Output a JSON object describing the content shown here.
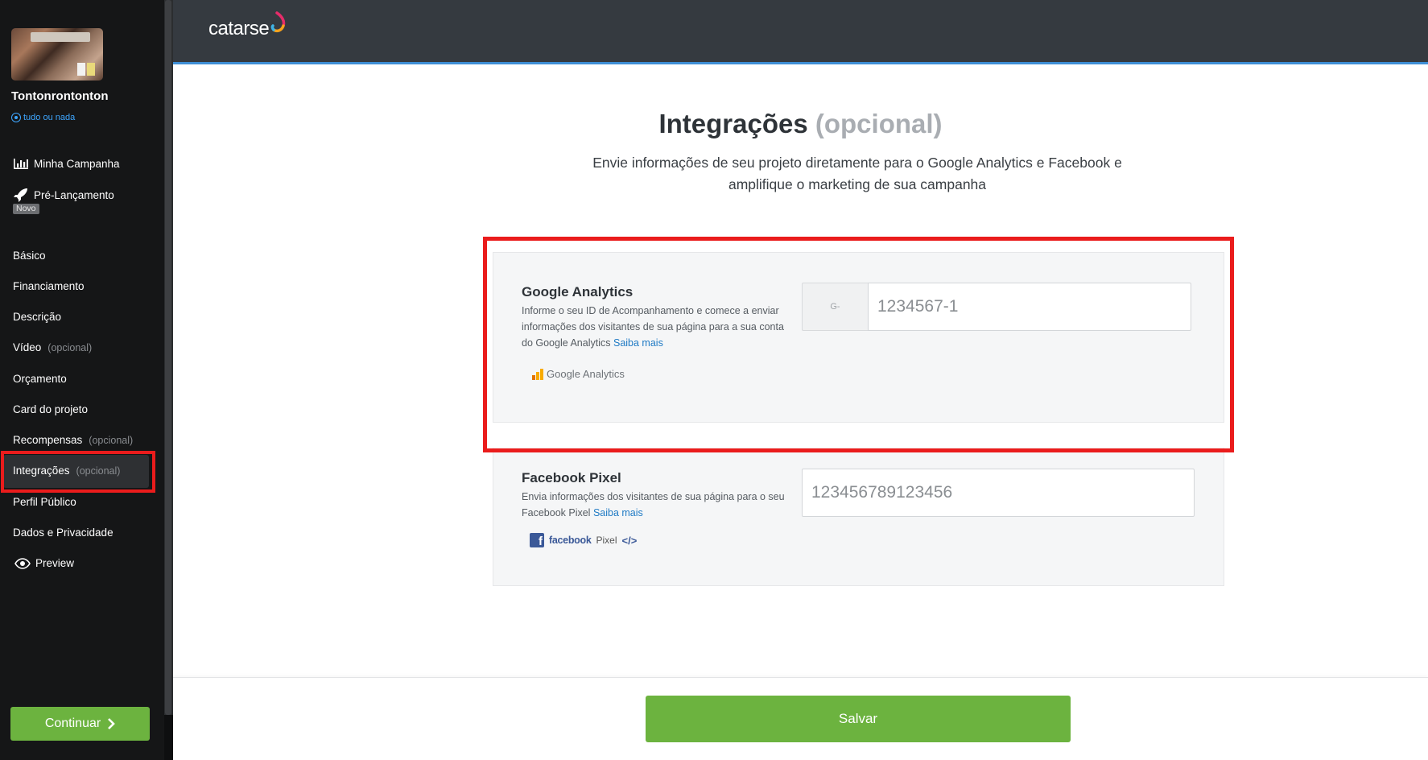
{
  "sidebar": {
    "project_name": "Tontonrontonton",
    "project_mode": "tudo ou nada",
    "primary": [
      {
        "label": "Minha Campanha",
        "icon": "bar-chart-icon"
      },
      {
        "label": "Pré-Lançamento",
        "icon": "rocket-icon",
        "badge": "Novo"
      }
    ],
    "items": [
      {
        "label": "Básico",
        "optional": ""
      },
      {
        "label": "Financiamento",
        "optional": ""
      },
      {
        "label": "Descrição",
        "optional": ""
      },
      {
        "label": "Vídeo",
        "optional": "(opcional)"
      },
      {
        "label": "Orçamento",
        "optional": ""
      },
      {
        "label": "Card do projeto",
        "optional": ""
      },
      {
        "label": "Recompensas",
        "optional": "(opcional)"
      },
      {
        "label": "Integrações",
        "optional": "(opcional)",
        "active": true
      },
      {
        "label": "Perfil Público",
        "optional": ""
      },
      {
        "label": "Dados e Privacidade",
        "optional": ""
      }
    ],
    "preview_label": "Preview",
    "continue_label": "Continuar"
  },
  "header": {
    "logo_text": "catarse"
  },
  "main": {
    "title": "Integrações",
    "title_suffix": "(opcional)",
    "subtitle": "Envie informações de seu projeto diretamente para o Google Analytics e Facebook e amplifique o marketing de sua campanha",
    "google_analytics": {
      "title": "Google Analytics",
      "description": "Informe o seu ID de Acompanhamento e comece a enviar informações dos visitantes de sua página para a sua conta do Google Analytics",
      "link": "Saiba mais",
      "prefix": "G-",
      "placeholder": "1234567-1",
      "logo_text": "Google Analytics"
    },
    "facebook_pixel": {
      "title": "Facebook Pixel",
      "description": "Envia informações dos visitantes de sua página para o seu Facebook Pixel",
      "link": "Saiba mais",
      "placeholder": "123456789123456",
      "logo_word": "facebook",
      "logo_pixel": "Pixel",
      "logo_code": "</>"
    }
  },
  "footer": {
    "save_label": "Salvar"
  },
  "colors": {
    "accent_green": "#6cb33f",
    "header_bg": "#353a40",
    "highlight_red": "#ea1c1c",
    "link_blue": "#1f7ac4"
  }
}
